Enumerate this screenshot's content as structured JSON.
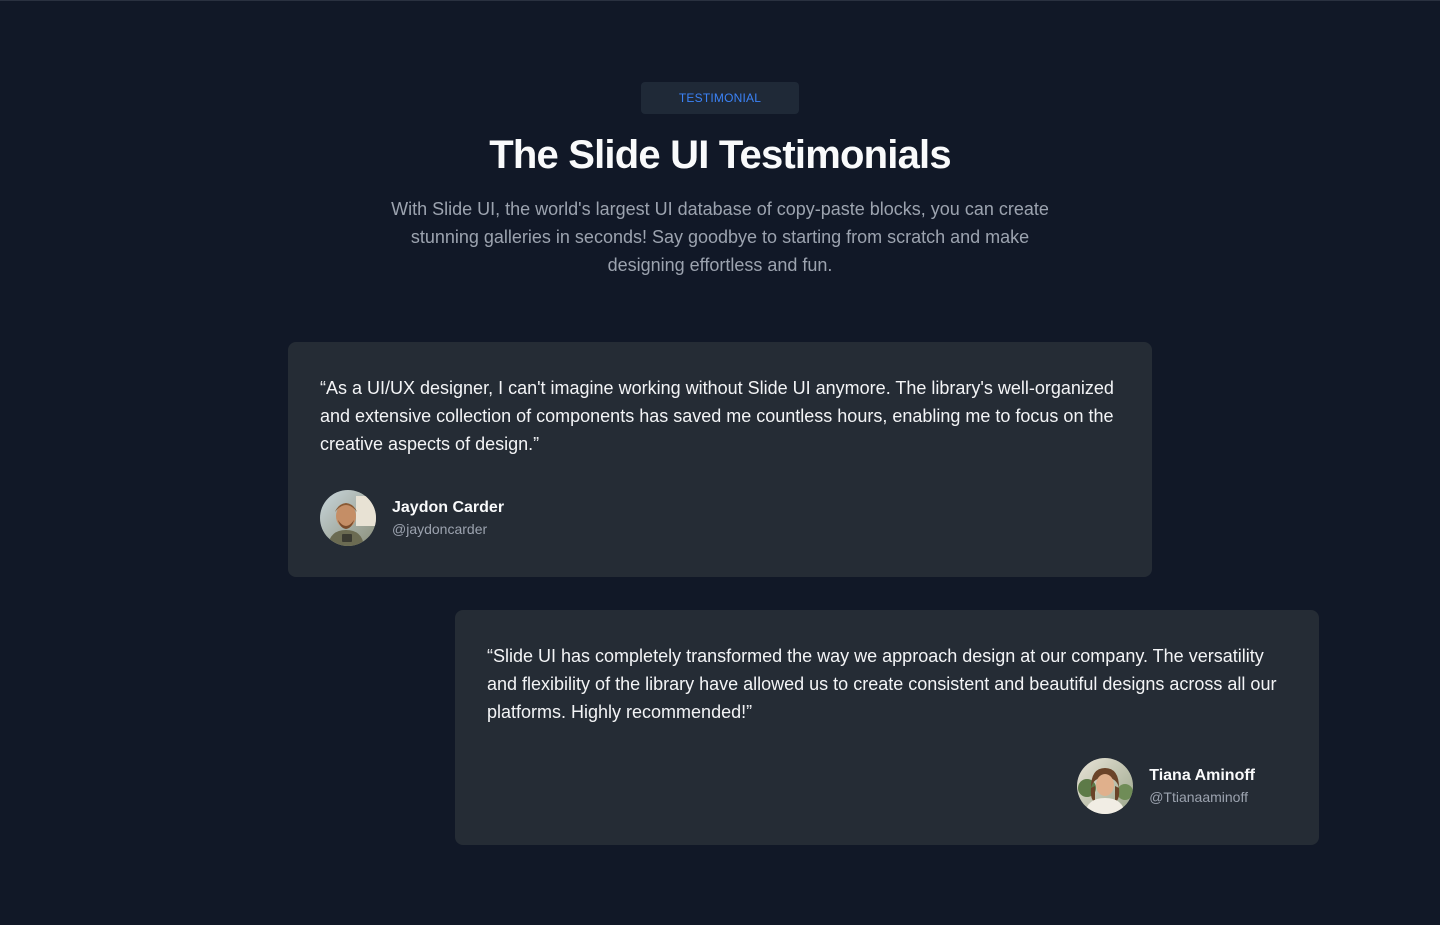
{
  "header": {
    "badge": "TESTIMONIAL",
    "title": "The Slide UI Testimonials",
    "subtitle": "With Slide UI, the world's largest UI database of copy-paste blocks, you can create stunning galleries in seconds! Say goodbye to starting from scratch and make designing effortless and fun."
  },
  "testimonials": [
    {
      "quote": "“As a UI/UX designer, I can't imagine working without Slide UI anymore. The library's well-organized and extensive collection of components has saved me countless hours, enabling me to focus on the creative aspects of design.”",
      "name": "Jaydon Carder",
      "handle": "@jaydoncarder",
      "avatar_icon": "user-avatar-photo"
    },
    {
      "quote": "“Slide UI has completely transformed the way we approach design at our company. The versatility and flexibility of the library have allowed us to create consistent and beautiful designs across all our platforms. Highly recommended!”",
      "name": "Tiana Aminoff",
      "handle": "@Ttianaaminoff",
      "avatar_icon": "user-avatar-photo"
    }
  ],
  "colors": {
    "background": "#111827",
    "card": "#252c35",
    "accent": "#3b82f6"
  }
}
